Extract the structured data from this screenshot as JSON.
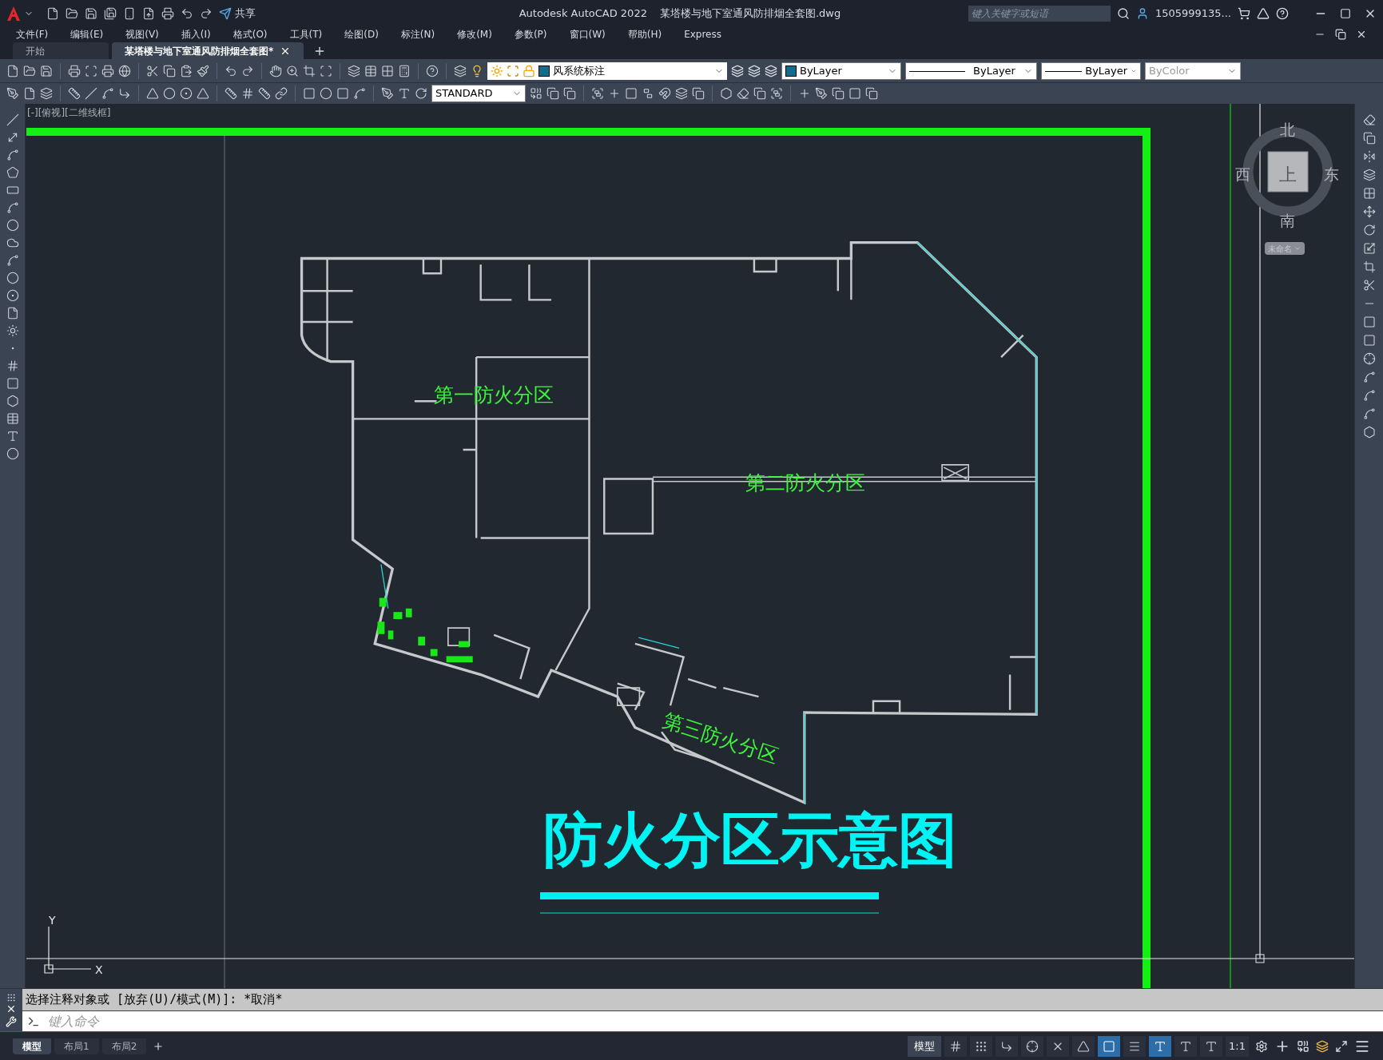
{
  "title_bar": {
    "share": "共享",
    "app_title": "Autodesk AutoCAD 2022",
    "document_title": "某塔楼与地下室通风防排烟全套图.dwg",
    "search": {
      "placeholder": "键入关键字或短语"
    },
    "user": "1505999135..."
  },
  "menu": [
    "文件(F)",
    "编辑(E)",
    "视图(V)",
    "插入(I)",
    "格式(O)",
    "工具(T)",
    "绘图(D)",
    "标注(N)",
    "修改(M)",
    "参数(P)",
    "窗口(W)",
    "帮助(H)",
    "Express"
  ],
  "doc_tabs": [
    {
      "label": "开始",
      "selected": false
    },
    {
      "label": "某塔楼与地下室通风防排烟全套图*",
      "selected": true
    }
  ],
  "toolbar": {
    "layer": "风系统标注",
    "color_setting": "ByLayer",
    "linetype": "ByLayer",
    "lineweight": "ByLayer",
    "plot_style": {
      "value": "ByColor",
      "disabled": true
    },
    "text_style": "STANDARD"
  },
  "viewport": {
    "label": "[-][俯视][二维线框]",
    "zones": [
      {
        "label": "第一防火分区",
        "kind": "flat"
      },
      {
        "label": "第二防火分区",
        "kind": "flat"
      },
      {
        "label": "第三防火分区",
        "kind": "rotated"
      }
    ],
    "title": "防火分区示意图",
    "ucs": {
      "x": "X",
      "y": "Y"
    }
  },
  "viewcube": {
    "north": "北",
    "south": "南",
    "west": "西",
    "east": "东",
    "face": "上",
    "view_name": "未命名"
  },
  "command": {
    "history": "选择注释对象或 [放弃(U)/模式(M)]: *取消*",
    "placeholder": "键入命令"
  },
  "layout_tabs": [
    {
      "label": "模型",
      "selected": true
    },
    {
      "label": "布局1",
      "selected": false
    },
    {
      "label": "布局2",
      "selected": false
    }
  ],
  "status_bar": {
    "space": "模型",
    "scale": "1:1",
    "toggles": [
      {
        "kind": "grid",
        "on": false
      },
      {
        "kind": "snap",
        "on": false
      },
      {
        "kind": "ortho",
        "on": false
      },
      {
        "kind": "polar",
        "on": false
      },
      {
        "kind": "iso",
        "on": false
      },
      {
        "kind": "angle",
        "on": false
      },
      {
        "kind": "osnap",
        "on": true
      },
      {
        "kind": "lineweight",
        "on": false
      },
      {
        "kind": "annovis",
        "on": true
      },
      {
        "kind": "autoscale",
        "on": false
      },
      {
        "kind": "annoscale",
        "on": false
      }
    ]
  }
}
